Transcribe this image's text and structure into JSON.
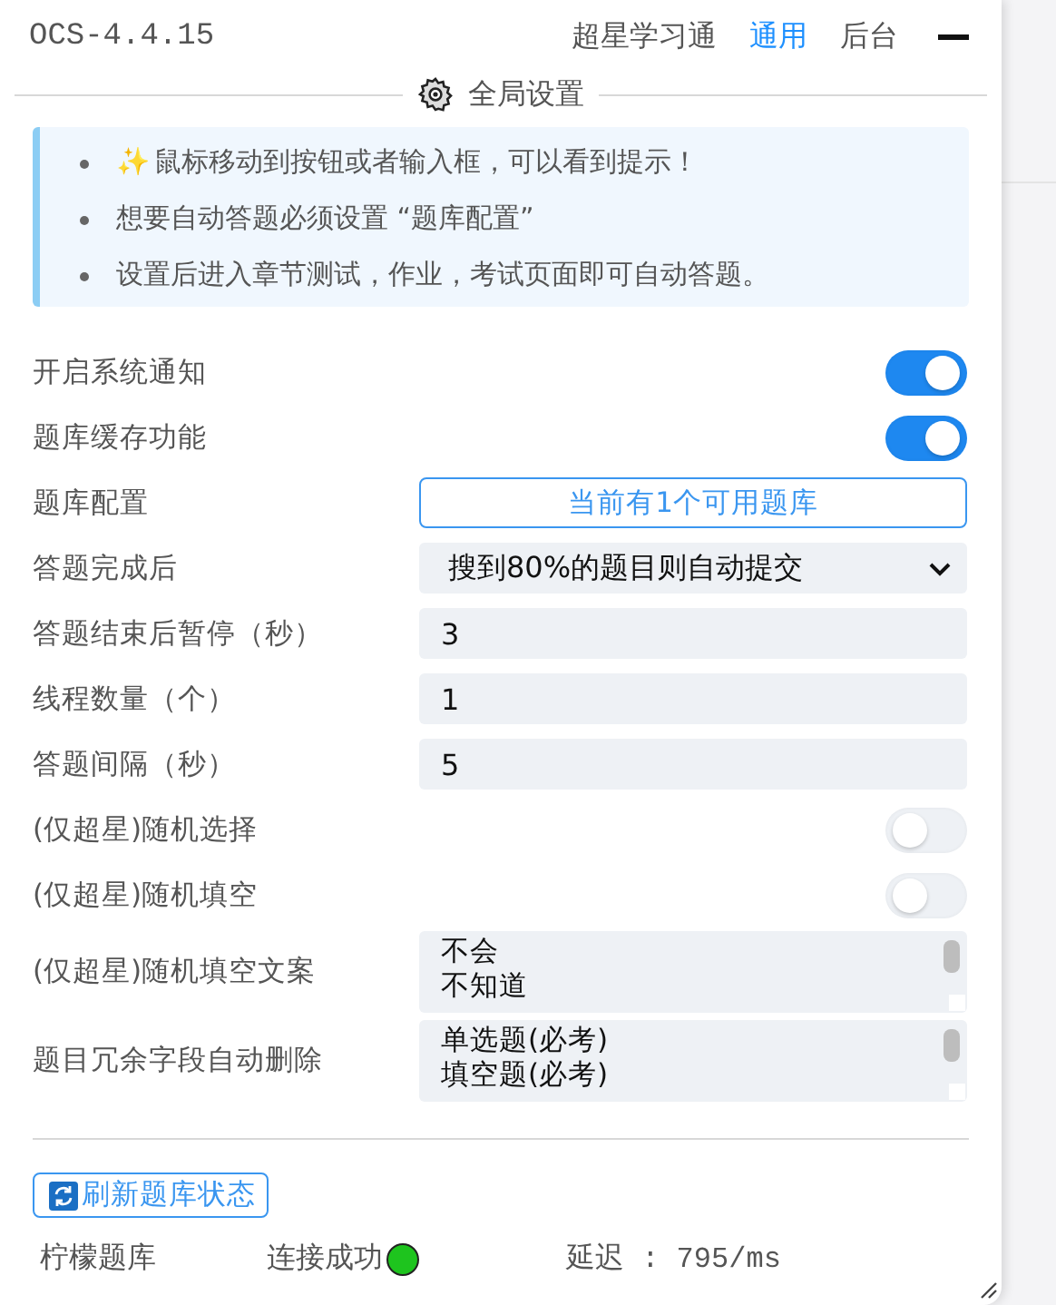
{
  "header": {
    "title": "OCS-4.4.15",
    "tabs": [
      {
        "label": "超星学习通",
        "selected": false
      },
      {
        "label": "通用",
        "selected": true
      },
      {
        "label": "后台",
        "selected": false
      }
    ]
  },
  "section": {
    "title": "全局设置"
  },
  "notices": [
    {
      "icon": "✨",
      "text": "鼠标移动到按钮或者输入框，可以看到提示！"
    },
    {
      "text": "想要自动答题必须设置 “题库配置”"
    },
    {
      "text": "设置后进入章节测试，作业，考试页面即可自动答题。"
    }
  ],
  "settings": [
    {
      "kind": "toggle",
      "label": "开启系统通知",
      "on": true
    },
    {
      "kind": "toggle",
      "label": "题库缓存功能",
      "on": true
    },
    {
      "kind": "button",
      "label": "题库配置",
      "value": "当前有1个可用题库"
    },
    {
      "kind": "select",
      "label": "答题完成后",
      "value": "搜到80%的题目则自动提交"
    },
    {
      "kind": "input",
      "label": "答题结束后暂停（秒）",
      "value": "3"
    },
    {
      "kind": "input",
      "label": "线程数量（个）",
      "value": "1"
    },
    {
      "kind": "input",
      "label": "答题间隔（秒）",
      "value": "5"
    },
    {
      "kind": "toggle",
      "label": "(仅超星)随机选择",
      "on": false
    },
    {
      "kind": "toggle",
      "label": "(仅超星)随机填空",
      "on": false
    },
    {
      "kind": "textarea",
      "label": "(仅超星)随机填空文案",
      "lines": [
        "不会",
        "不知道"
      ]
    },
    {
      "kind": "textarea",
      "label": "题目冗余字段自动删除",
      "lines": [
        "单选题(必考)",
        "填空题(必考)"
      ]
    }
  ],
  "footer": {
    "refresh_button": "刷新题库状态",
    "bank_name": "柠檬题库",
    "status": "连接成功",
    "latency": "延迟 : 795/ms"
  }
}
